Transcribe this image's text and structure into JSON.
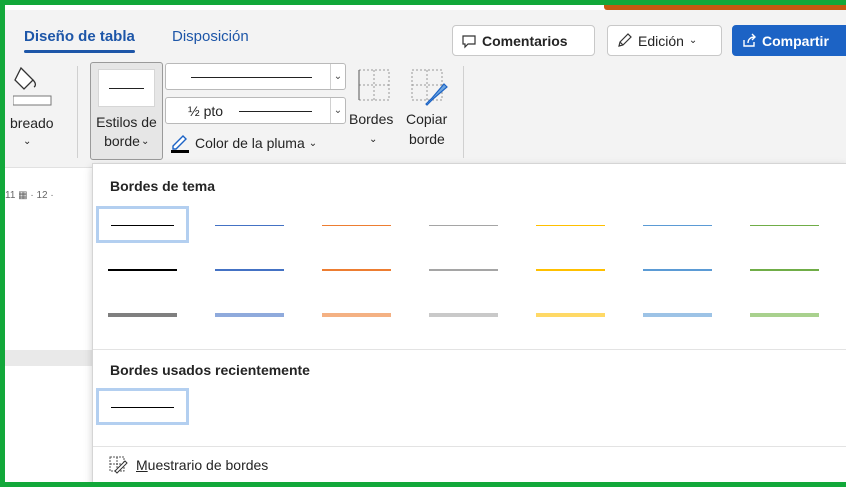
{
  "tabs": [
    {
      "label": "Diseño de tabla",
      "active": true
    },
    {
      "label": "Disposición",
      "active": false
    }
  ],
  "header": {
    "comentarios": "Comentarios",
    "edicion": "Edición",
    "compartir": "Compartir"
  },
  "ribbon": {
    "sombreado_partial": "breado",
    "estilos_line1": "Estilos de",
    "estilos_line2": "borde",
    "line_weight": "½ pto",
    "pen_color": "Color de la pluma",
    "bordes": "Bordes",
    "copiar_line1": "Copiar",
    "copiar_line2": "borde",
    "ruler": "11 ▦ · 12 ·"
  },
  "panel": {
    "theme_title": "Bordes de tema",
    "recent_title": "Bordes usados recientemente",
    "painter_prefix": "M",
    "painter_rest": "uestrario de bordes"
  },
  "theme_colors": {
    "row1": [
      "#000000",
      "#4472c4",
      "#ed7d31",
      "#a5a5a5",
      "#ffc000",
      "#5b9bd5",
      "#70ad47"
    ],
    "row2": [
      "#000000",
      "#4472c4",
      "#ed7d31",
      "#a5a5a5",
      "#ffc000",
      "#5b9bd5",
      "#70ad47"
    ],
    "row3": [
      "#7f7f7f",
      "#8faadc",
      "#f4b183",
      "#c9c9c9",
      "#ffd966",
      "#9dc3e6",
      "#a9d18e"
    ]
  },
  "colors": {
    "accent": "#1c63c5",
    "frame": "#12a83a",
    "banner": "#c55a11"
  }
}
